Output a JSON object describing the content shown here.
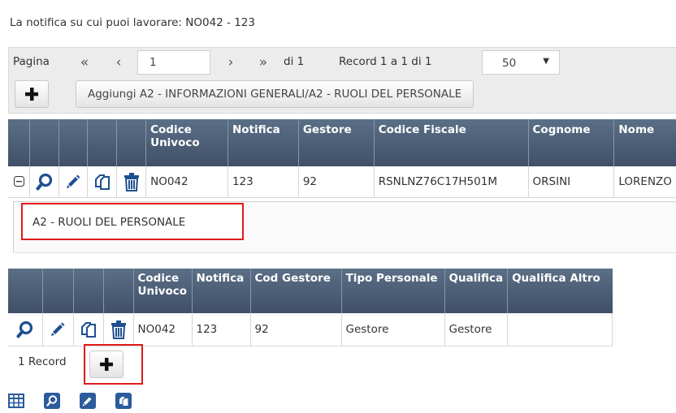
{
  "page_title": "La notifica su cui puoi lavorare: NO042 - 123",
  "pager": {
    "page_label": "Pagina",
    "first_icon": "double-chevron-left-icon",
    "prev_icon": "chevron-left-icon",
    "next_icon": "chevron-right-icon",
    "last_icon": "double-chevron-right-icon",
    "first_glyph": "«",
    "prev_glyph": "‹",
    "next_glyph": "›",
    "last_glyph": "»",
    "page_value": "1",
    "of_label": "di 1",
    "records_label": "Record 1 a 1 di 1",
    "page_size": "50"
  },
  "toolbar": {
    "add_icon": "plus-icon",
    "add_label": "Aggiungi A2 - INFORMAZIONI GENERALI/A2 - RUOLI DEL PERSONALE"
  },
  "main_table": {
    "columns": [
      "Codice Univoco",
      "Notifica",
      "Gestore",
      "Codice Fiscale",
      "Cognome",
      "Nome"
    ],
    "row": {
      "expand_icon": "collapse-minus-icon",
      "actions": [
        "search-icon",
        "pencil-icon",
        "copy-icon",
        "trash-icon"
      ],
      "cells": [
        "NO042",
        "123",
        "92",
        "RSNLNZ76C17H501M",
        "ORSINI",
        "LORENZO"
      ]
    }
  },
  "subgrid": {
    "tab_label": "A2 - RUOLI DEL PERSONALE",
    "columns": [
      "Codice Univoco",
      "Notifica",
      "Cod Gestore",
      "Tipo Personale",
      "Qualifica",
      "Qualifica Altro"
    ],
    "row": {
      "actions": [
        "search-icon",
        "pencil-icon",
        "copy-icon",
        "trash-icon"
      ],
      "cells": [
        "NO042",
        "123",
        "92",
        "Gestore",
        "Gestore",
        ""
      ]
    },
    "records_count": "1 Record"
  },
  "footer_icons": [
    "grid-icon",
    "search-icon",
    "pencil-icon",
    "copy-icon"
  ],
  "colors": {
    "header_bg": "#4a5b72",
    "icon_blue": "#1f4f8f",
    "highlight_red": "#e01b1b"
  }
}
